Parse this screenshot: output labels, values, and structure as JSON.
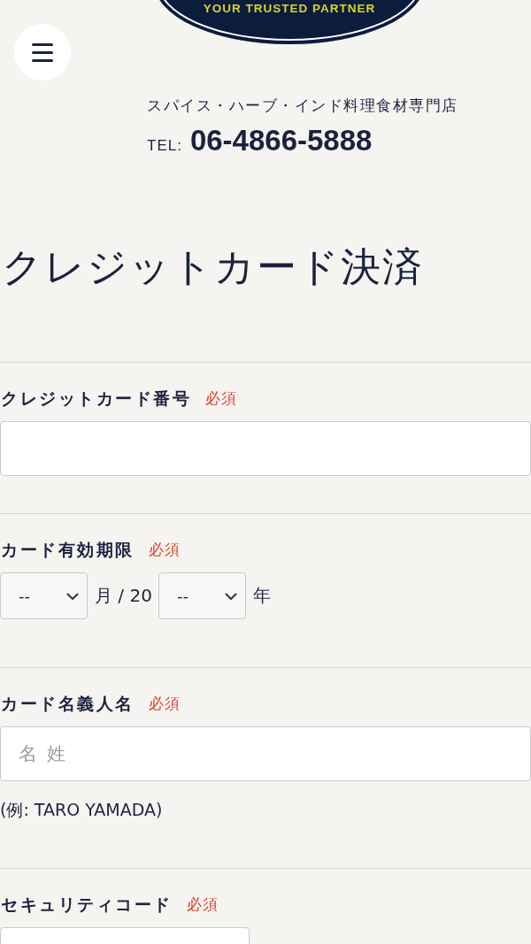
{
  "header": {
    "logo": {
      "tagline": "YOUR TRUSTED PARTNER"
    },
    "shop_description": "スパイス・ハーブ・インド料理食材専門店",
    "tel_label": "TEL:",
    "tel_number": "06-4866-5888"
  },
  "page_title": "クレジットカード決済",
  "form": {
    "fields": [
      {
        "kind": "text",
        "label": "クレジットカード番号",
        "required_badge": "必須"
      },
      {
        "kind": "expiry",
        "label": "カード有効期限",
        "required_badge": "必須",
        "month_select": "--",
        "separator": "月 / 20",
        "year_select": "--",
        "year_suffix": "年"
      },
      {
        "kind": "text",
        "label": "カード名義人名",
        "required_badge": "必須",
        "placeholder": "名 姓",
        "hint": "(例: TARO YAMADA)"
      },
      {
        "kind": "short_text",
        "label": "セキュリティコード",
        "required_badge": "必須"
      }
    ]
  }
}
